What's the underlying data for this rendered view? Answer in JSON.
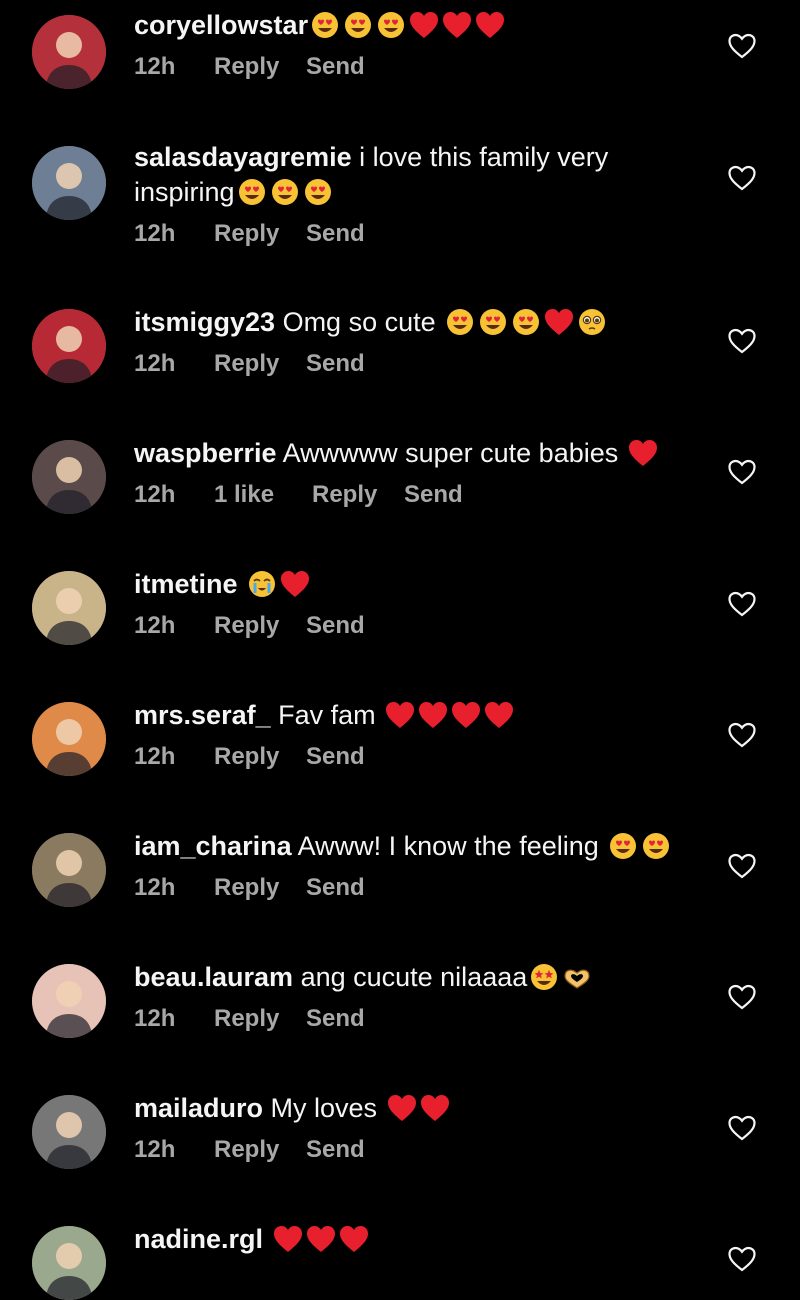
{
  "comments": [
    {
      "user": "coryellowstar",
      "text": "",
      "emojis": [
        "heart-eyes",
        "heart-eyes",
        "heart-eyes",
        "red-heart",
        "red-heart",
        "red-heart"
      ],
      "time": "12h",
      "likes": "",
      "reply": "Reply",
      "send": "Send",
      "avatar_color": "#b4303a"
    },
    {
      "user": "salasdayagremie",
      "text": " i love this family very",
      "text2": "inspiring",
      "emojis": [
        "heart-eyes",
        "heart-eyes",
        "heart-eyes"
      ],
      "time": "12h",
      "likes": "",
      "reply": "Reply",
      "send": "Send",
      "avatar_color": "#6e7f95"
    },
    {
      "user": "itsmiggy23",
      "text": " Omg so cute ",
      "emojis": [
        "heart-eyes",
        "heart-eyes",
        "heart-eyes",
        "red-heart",
        "pleading"
      ],
      "time": "12h",
      "likes": "",
      "reply": "Reply",
      "send": "Send",
      "avatar_color": "#b72a35"
    },
    {
      "user": "waspberrie",
      "text": " Awwwww super cute babies ",
      "emojis": [
        "red-heart"
      ],
      "time": "12h",
      "likes": "1 like",
      "reply": "Reply",
      "send": "Send",
      "avatar_color": "#5a4a4a"
    },
    {
      "user": "itmetine",
      "text": " ",
      "emojis": [
        "crying-face",
        "red-heart"
      ],
      "time": "12h",
      "likes": "",
      "reply": "Reply",
      "send": "Send",
      "avatar_color": "#c9b48a"
    },
    {
      "user": "mrs.seraf_",
      "text": " Fav fam ",
      "emojis": [
        "red-heart",
        "red-heart",
        "red-heart",
        "red-heart"
      ],
      "time": "12h",
      "likes": "",
      "reply": "Reply",
      "send": "Send",
      "avatar_color": "#e08a4a"
    },
    {
      "user": "iam_charina",
      "text": " Awww! I know the feeling ",
      "emojis": [
        "heart-eyes",
        "heart-eyes"
      ],
      "time": "12h",
      "likes": "",
      "reply": "Reply",
      "send": "Send",
      "avatar_color": "#8a7a60"
    },
    {
      "user": "beau.lauram",
      "text": " ang cucute nilaaaa",
      "emojis": [
        "star-struck",
        "heart-hands"
      ],
      "time": "12h",
      "likes": "",
      "reply": "Reply",
      "send": "Send",
      "avatar_color": "#e6c3b6"
    },
    {
      "user": "mailaduro",
      "text": " My loves ",
      "emojis": [
        "red-heart",
        "red-heart"
      ],
      "time": "12h",
      "likes": "",
      "reply": "Reply",
      "send": "Send",
      "avatar_color": "#777777"
    },
    {
      "user": "nadine.rgl",
      "text": " ",
      "emojis": [
        "red-heart",
        "red-heart",
        "red-heart"
      ],
      "time": "",
      "likes": "",
      "reply": "",
      "send": "",
      "avatar_color": "#9aa88e"
    }
  ],
  "colors": {
    "background": "#000000",
    "text": "#f5f5f5",
    "meta": "#a8a8a8"
  }
}
